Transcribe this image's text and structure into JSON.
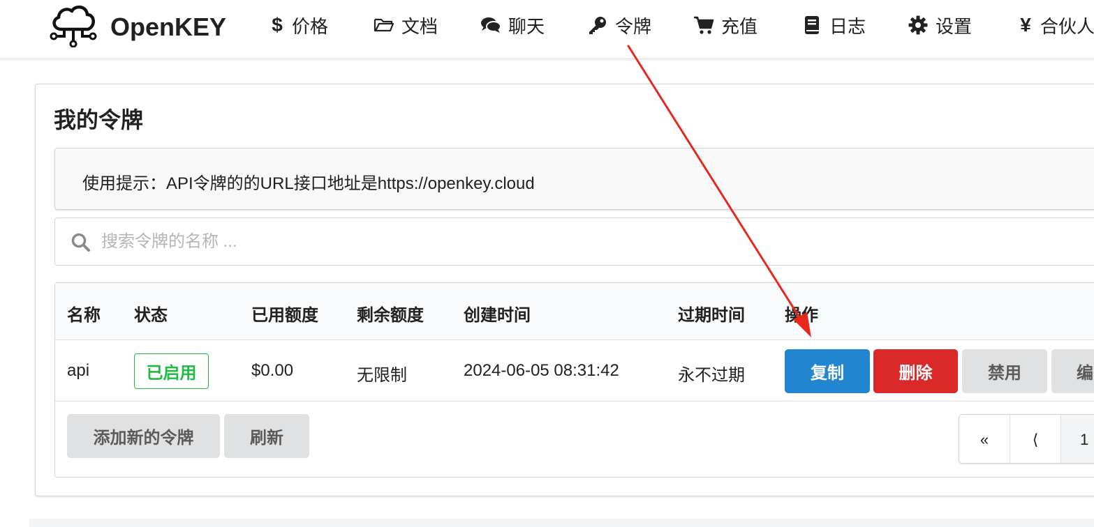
{
  "brand": {
    "name": "OpenKEY",
    "logo_icon": "cloud-network-icon"
  },
  "nav": [
    {
      "icon": "dollar-icon",
      "glyph": "$",
      "label": "价格"
    },
    {
      "icon": "folder-open-icon",
      "glyph": "",
      "label": "文档"
    },
    {
      "icon": "comments-icon",
      "glyph": "",
      "label": "聊天"
    },
    {
      "icon": "key-icon",
      "glyph": "",
      "label": "令牌"
    },
    {
      "icon": "cart-icon",
      "glyph": "",
      "label": "充值"
    },
    {
      "icon": "book-icon",
      "glyph": "",
      "label": "日志"
    },
    {
      "icon": "gear-icon",
      "glyph": "",
      "label": "设置"
    },
    {
      "icon": "yen-icon",
      "glyph": "¥",
      "label": "合伙人"
    }
  ],
  "page": {
    "title": "我的令牌",
    "tip": "使用提示：API令牌的的URL接口地址是https://openkey.cloud",
    "search_placeholder": "搜索令牌的名称 ..."
  },
  "table": {
    "headers": [
      "名称",
      "状态",
      "已用额度",
      "剩余额度",
      "创建时间",
      "过期时间",
      "操作"
    ],
    "rows": [
      {
        "name": "api",
        "status": "已启用",
        "used": "$0.00",
        "remaining": "无限制",
        "created": "2024-06-05 08:31:42",
        "expires": "永不过期",
        "actions": {
          "copy": "复制",
          "delete": "删除",
          "disable": "禁用",
          "edit": "编"
        }
      }
    ]
  },
  "footer_buttons": {
    "add": "添加新的令牌",
    "refresh": "刷新"
  },
  "pagination": {
    "first": "«",
    "prev": "⟨",
    "current": "1"
  },
  "colors": {
    "primary": "#2185d0",
    "danger": "#db2828",
    "success": "#21ba45",
    "annotation": "#e8281f"
  }
}
